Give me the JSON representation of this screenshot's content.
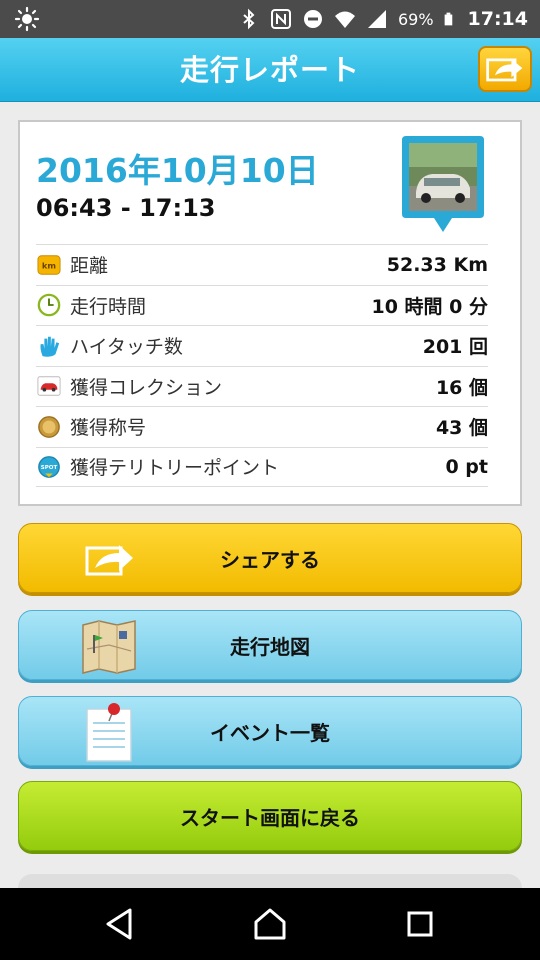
{
  "status_bar": {
    "battery_percent": "69%",
    "time": "17:14",
    "icons": [
      "brightness-icon",
      "bluetooth-icon",
      "nfc-icon",
      "do-not-disturb-icon",
      "wifi-icon",
      "signal-icon",
      "battery-icon"
    ]
  },
  "header": {
    "title": "走行レポート",
    "share_icon": "share-arrow-icon"
  },
  "report": {
    "date": "2016年10月10日",
    "time_range": "06:43 - 17:13",
    "stats": [
      {
        "icon": "km-icon",
        "label": "距離",
        "value": "52.33 Km"
      },
      {
        "icon": "clock-icon",
        "label": "走行時間",
        "value": "10 時間 0 分"
      },
      {
        "icon": "high-touch-hand-icon",
        "label": "ハイタッチ数",
        "value": "201 回"
      },
      {
        "icon": "car-collection-icon",
        "label": "獲得コレクション",
        "value": "16 個"
      },
      {
        "icon": "title-medal-icon",
        "label": "獲得称号",
        "value": "43 個"
      },
      {
        "icon": "spot-icon",
        "label": "獲得テリトリーポイント",
        "value": "0 pt"
      }
    ],
    "km_badge": "km",
    "spot_badge": "SPOT"
  },
  "buttons": {
    "share": "シェアする",
    "map": "走行地図",
    "events": "イベント一覧",
    "back_to_start": "スタート画面に戻る"
  },
  "colors": {
    "header": "#29b8e4",
    "date": "#2aa8d6",
    "share_button": "#f7c800",
    "blue_button": "#8fd8ef",
    "green_button": "#acdc1f"
  }
}
